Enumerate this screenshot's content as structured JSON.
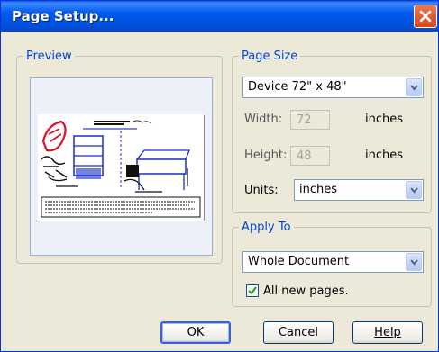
{
  "window": {
    "title": "Page Setup..."
  },
  "preview": {
    "legend": "Preview"
  },
  "page_size": {
    "legend": "Page Size",
    "selected_size": "Device 72\" x 48\"",
    "width_label": "Width:",
    "width_value": "72",
    "width_unit": "inches",
    "height_label": "Height:",
    "height_value": "48",
    "height_unit": "inches",
    "units_label": "Units:",
    "units_value": "inches"
  },
  "apply_to": {
    "legend": "Apply To",
    "selected": "Whole Document",
    "checkbox_label": "All new pages.",
    "checkbox_checked": true
  },
  "buttons": {
    "ok": "OK",
    "cancel": "Cancel",
    "help": "Help"
  },
  "colors": {
    "title_bar": "#0054e3",
    "close_button": "#d4441c",
    "legend_text": "#0046d5",
    "dialog_bg": "#ece9d8"
  },
  "icons": {
    "close": "close-icon",
    "dropdown": "chevron-down-icon",
    "check": "checkmark-icon"
  }
}
